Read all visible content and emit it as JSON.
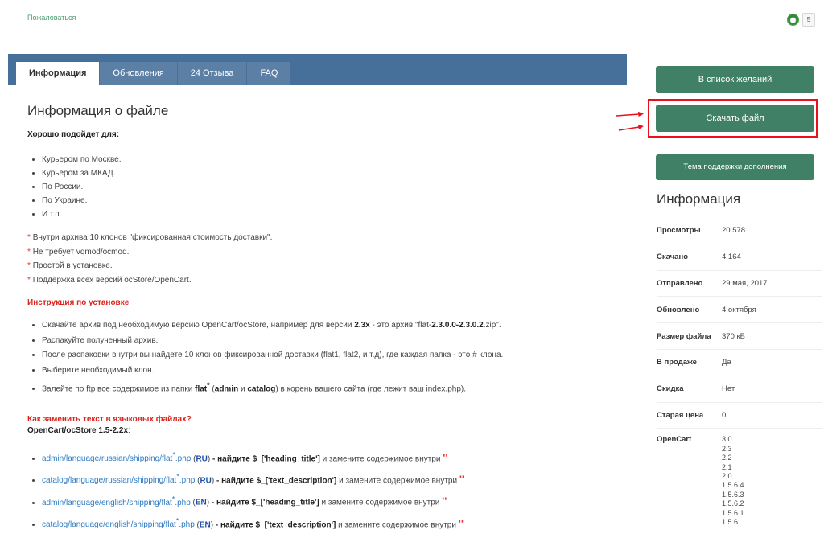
{
  "topbar": {
    "complain": "Пожаловаться",
    "badge_count": "5"
  },
  "tabs": [
    {
      "label": "Информация",
      "active": true
    },
    {
      "label": "Обновления",
      "active": false
    },
    {
      "label": "24 Отзыва",
      "active": false
    },
    {
      "label": "FAQ",
      "active": false
    }
  ],
  "main": {
    "title": "Информация о файле",
    "good_for_heading": "Хорошо подойдет для:",
    "good_for": [
      "Курьером по Москве.",
      "Курьером за МКАД.",
      "По России.",
      "По Украине.",
      "И т.п."
    ],
    "notes": [
      "Внутри архива 10 клонов \"фиксированная стоимость доставки\".",
      "Не требует vqmod/ocmod.",
      "Простой в установке.",
      "Поддержка всех версий ocStore/OpenCart."
    ],
    "install_heading": "Инструкция по установке",
    "install": {
      "s1a": "Скачайте архив под необходимую версию OpenCart/ocStore, например для версии ",
      "s1b": "2.3x",
      "s1c": " - это архив \"flat-",
      "s1d": "2.3.0.0-2.3.0.2",
      "s1e": ".zip\".",
      "s2": "Распакуйте полученный архив.",
      "s3": "После распаковки внутри вы найдете 10 клонов фиксированной доставки (flat1, flat2, и т.д), где каждая папка - это # клона.",
      "s4": "Выберите необходимый клон.",
      "s5a": "Залейте по ftp все содержимое из папки ",
      "s5b": "flat",
      "s5c": "*",
      "s5d": " (",
      "s5e": "admin",
      "s5f": " и ",
      "s5g": "catalog",
      "s5h": ") в корень вашего сайта (где лежит ваш index.php)."
    },
    "howto_heading": "Как заменить текст в языковых файлах?",
    "howto_sub": "OpenCart/ocStore 1.5-2.2x",
    "howto_sub_colon": ":",
    "lang_items": [
      {
        "path": "admin/language/russian/shipping/flat",
        "lang": "RU",
        "key": "$_['heading_title']"
      },
      {
        "path": "catalog/language/russian/shipping/flat",
        "lang": "RU",
        "key": "$_['text_description']"
      },
      {
        "path": "admin/language/english/shipping/flat",
        "lang": "EN",
        "key": "$_['heading_title']"
      },
      {
        "path": "catalog/language/english/shipping/flat",
        "lang": "EN",
        "key": "$_['text_description']"
      }
    ],
    "lang_star": "*",
    "lang_ext": ".php",
    "lang_find": "- найдите",
    "lang_replace": "и замените содержимое внутри",
    "lang_quote": "''"
  },
  "sidebar": {
    "wishlist": "В список желаний",
    "download": "Скачать файл",
    "support": "Тема поддержки дополнения",
    "info_title": "Информация",
    "info": [
      {
        "k": "Просмотры",
        "v": "20 578"
      },
      {
        "k": "Скачано",
        "v": "4 164"
      },
      {
        "k": "Отправлено",
        "v": "29 мая, 2017"
      },
      {
        "k": "Обновлено",
        "v": "4 октября"
      },
      {
        "k": "Размер файла",
        "v": "370 кБ"
      },
      {
        "k": "В продаже",
        "v": "Да"
      },
      {
        "k": "Скидка",
        "v": "Нет"
      },
      {
        "k": "Старая цена",
        "v": "0"
      }
    ],
    "opencart_label": "OpenCart",
    "versions": [
      "3.0",
      "2.3",
      "2.2",
      "2.1",
      "2.0",
      "1.5.6.4",
      "1.5.6.3",
      "1.5.6.2",
      "1.5.6.1",
      "1.5.6"
    ]
  },
  "colors": {
    "accent": "#408066",
    "tabbar": "#466f99",
    "highlight": "#e8101b",
    "red_text": "#d9241c"
  }
}
